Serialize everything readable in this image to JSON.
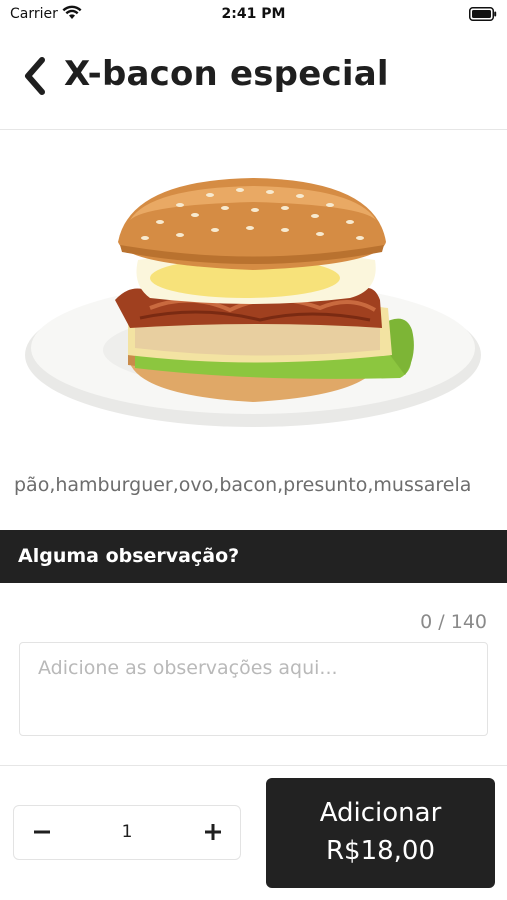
{
  "status_bar": {
    "carrier": "Carrier",
    "time": "2:41 PM",
    "wifi_icon": "wifi-icon",
    "battery_icon": "battery-icon"
  },
  "header": {
    "back_icon": "chevron-left-icon",
    "title": "X-bacon especial"
  },
  "product": {
    "image_icon": "burger-image",
    "ingredients": "pão,hamburguer,ovo,bacon,presunto,mussarela"
  },
  "notes": {
    "section_title": "Alguma observação?",
    "counter": "0 / 140",
    "placeholder": "Adicione as observações aqui...",
    "value": ""
  },
  "footer": {
    "quantity": "1",
    "minus_icon": "minus-icon",
    "plus_icon": "plus-icon",
    "add_label": "Adicionar",
    "price": "R$18,00"
  },
  "colors": {
    "dark": "#222222",
    "text": "#1f1f1f",
    "muted": "#8a8a8a"
  }
}
